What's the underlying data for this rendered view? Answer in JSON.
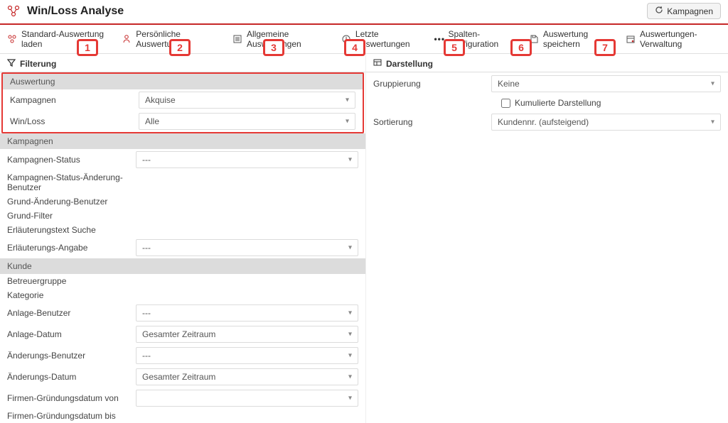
{
  "header": {
    "title": "Win/Loss Analyse",
    "kampagnen_button": "Kampagnen"
  },
  "toolbar": {
    "items": [
      {
        "label": "Standard-Auswertung laden"
      },
      {
        "label": "Persönliche Auswertungen"
      },
      {
        "label": "Allgemeine Auswertungen"
      },
      {
        "label": "Letzte Auswertungen"
      },
      {
        "label": "Spalten-Konfiguration"
      },
      {
        "label": "Auswertung speichern"
      },
      {
        "label": "Auswertungen-Verwaltung"
      }
    ],
    "badges": [
      "1",
      "2",
      "3",
      "4",
      "5",
      "6",
      "7"
    ]
  },
  "filtering": {
    "header": "Filterung",
    "sections": {
      "auswertung": {
        "title": "Auswertung",
        "fields": [
          {
            "label": "Kampagnen",
            "value": "Akquise"
          },
          {
            "label": "Win/Loss",
            "value": "Alle"
          }
        ]
      },
      "kampagnen": {
        "title": "Kampagnen",
        "fields": [
          {
            "label": "Kampagnen-Status",
            "value": "---"
          },
          {
            "label": "Kampagnen-Status-Änderung-Benutzer",
            "value": ""
          },
          {
            "label": "Grund-Änderung-Benutzer",
            "value": ""
          },
          {
            "label": "Grund-Filter",
            "value": ""
          },
          {
            "label": "Erläuterungstext Suche",
            "value": ""
          },
          {
            "label": "Erläuterungs-Angabe",
            "value": "---"
          }
        ]
      },
      "kunde": {
        "title": "Kunde",
        "fields": [
          {
            "label": "Betreuergruppe",
            "value": ""
          },
          {
            "label": "Kategorie",
            "value": ""
          },
          {
            "label": "Anlage-Benutzer",
            "value": "---"
          },
          {
            "label": "Anlage-Datum",
            "value": "Gesamter Zeitraum"
          },
          {
            "label": "Änderungs-Benutzer",
            "value": "---"
          },
          {
            "label": "Änderungs-Datum",
            "value": "Gesamter Zeitraum"
          },
          {
            "label": "Firmen-Gründungsdatum von",
            "value": ""
          },
          {
            "label": "Firmen-Gründungsdatum bis",
            "value": ""
          }
        ]
      }
    }
  },
  "darstellung": {
    "header": "Darstellung",
    "gruppierung_label": "Gruppierung",
    "gruppierung_value": "Keine",
    "kumulierte_label": "Kumulierte Darstellung",
    "kumulierte_checked": false,
    "sortierung_label": "Sortierung",
    "sortierung_value": "Kundennr. (aufsteigend)"
  }
}
